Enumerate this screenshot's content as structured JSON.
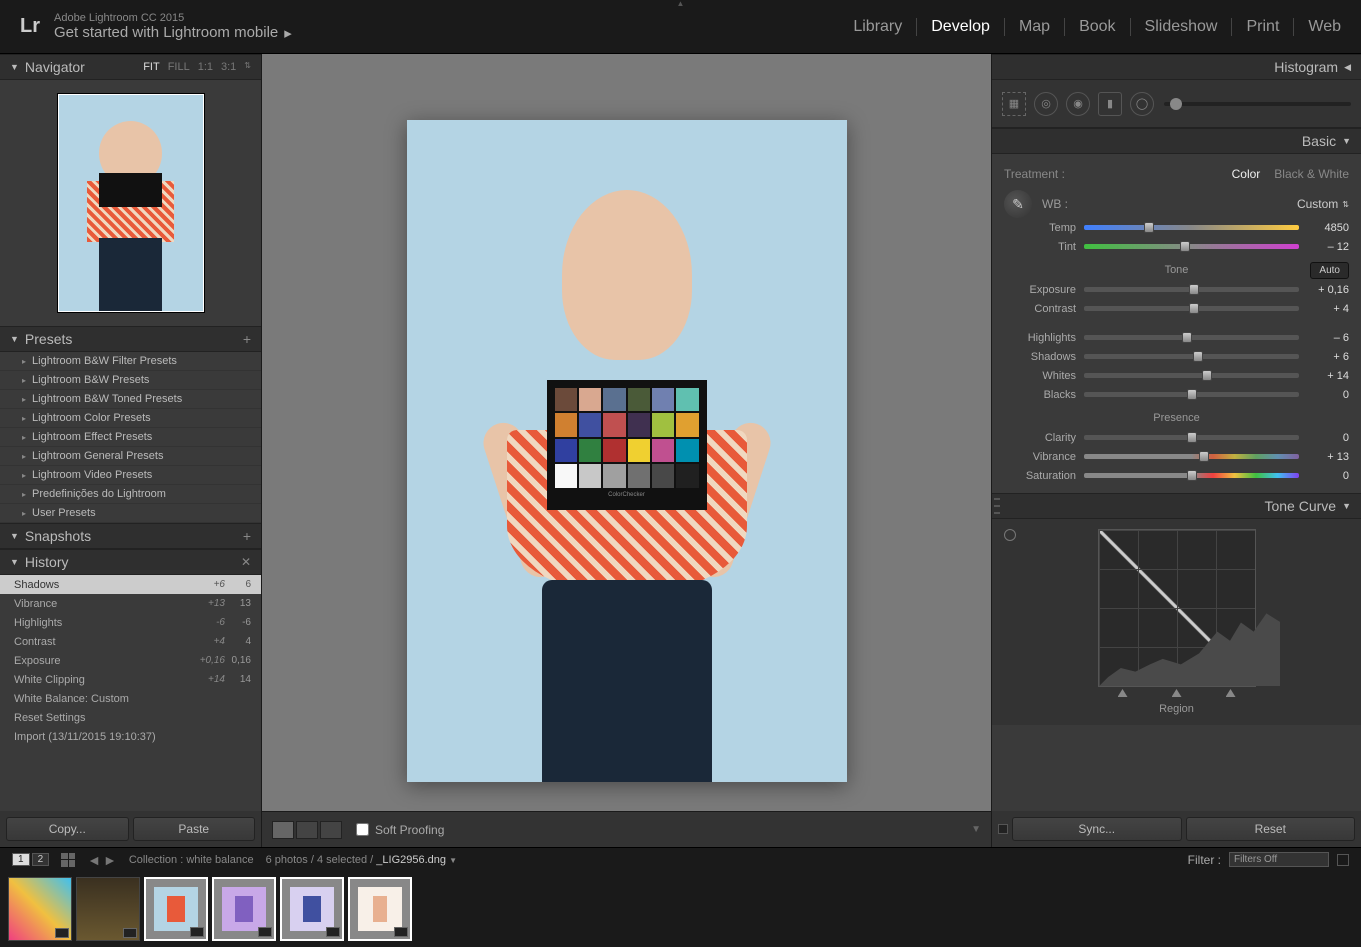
{
  "app": {
    "title": "Adobe Lightroom CC 2015",
    "subtitle": "Get started with Lightroom mobile",
    "logo_prefix": "Lr"
  },
  "modules": [
    "Library",
    "Develop",
    "Map",
    "Book",
    "Slideshow",
    "Print",
    "Web"
  ],
  "active_module": "Develop",
  "navigator": {
    "label": "Navigator",
    "zoom_modes": [
      "FIT",
      "FILL",
      "1:1",
      "3:1"
    ],
    "active_zoom": "FIT"
  },
  "presets": {
    "label": "Presets",
    "items": [
      "Lightroom B&W Filter Presets",
      "Lightroom B&W Presets",
      "Lightroom B&W Toned Presets",
      "Lightroom Color Presets",
      "Lightroom Effect Presets",
      "Lightroom General Presets",
      "Lightroom Video Presets",
      "Predefinições do Lightroom",
      "User Presets"
    ]
  },
  "snapshots": {
    "label": "Snapshots"
  },
  "history": {
    "label": "History",
    "items": [
      {
        "name": "Shadows",
        "delta": "+6",
        "val": "6",
        "sel": true
      },
      {
        "name": "Vibrance",
        "delta": "+13",
        "val": "13"
      },
      {
        "name": "Highlights",
        "delta": "-6",
        "val": "-6"
      },
      {
        "name": "Contrast",
        "delta": "+4",
        "val": "4"
      },
      {
        "name": "Exposure",
        "delta": "+0,16",
        "val": "0,16"
      },
      {
        "name": "White Clipping",
        "delta": "+14",
        "val": "14"
      },
      {
        "name": "White Balance: Custom",
        "delta": "",
        "val": ""
      },
      {
        "name": "Reset Settings",
        "delta": "",
        "val": ""
      },
      {
        "name": "Import (13/11/2015 19:10:37)",
        "delta": "",
        "val": ""
      }
    ]
  },
  "leftbtns": {
    "copy": "Copy...",
    "paste": "Paste"
  },
  "softproof": {
    "label": "Soft Proofing"
  },
  "histogram": {
    "label": "Histogram"
  },
  "basic": {
    "label": "Basic",
    "treatment_label": "Treatment :",
    "treatment_opts": [
      "Color",
      "Black & White"
    ],
    "treatment_active": "Color",
    "wb_label": "WB :",
    "wb_value": "Custom",
    "sliders": {
      "temp": {
        "label": "Temp",
        "value": "4850",
        "pos": 30
      },
      "tint": {
        "label": "Tint",
        "value": "– 12",
        "pos": 47
      }
    },
    "tone_label": "Tone",
    "auto_label": "Auto",
    "tone_sliders": [
      {
        "label": "Exposure",
        "value": "+ 0,16",
        "pos": 51
      },
      {
        "label": "Contrast",
        "value": "+ 4",
        "pos": 51
      }
    ],
    "tone_sliders2": [
      {
        "label": "Highlights",
        "value": "– 6",
        "pos": 48
      },
      {
        "label": "Shadows",
        "value": "+ 6",
        "pos": 53
      },
      {
        "label": "Whites",
        "value": "+ 14",
        "pos": 57
      },
      {
        "label": "Blacks",
        "value": "0",
        "pos": 50
      }
    ],
    "presence_label": "Presence",
    "presence_sliders": [
      {
        "label": "Clarity",
        "value": "0",
        "pos": 50,
        "track": "track-gray"
      },
      {
        "label": "Vibrance",
        "value": "+ 13",
        "pos": 56,
        "track": "track-vib"
      },
      {
        "label": "Saturation",
        "value": "0",
        "pos": 50,
        "track": "track-sat"
      }
    ]
  },
  "tonecurve": {
    "label": "Tone Curve",
    "region_label": "Region"
  },
  "rightbtns": {
    "sync": "Sync...",
    "reset": "Reset"
  },
  "filterbar": {
    "pages": [
      "1",
      "2"
    ],
    "collection": "Collection : white balance",
    "count": "6 photos / 4 selected /",
    "filename": "_LIG2956.dng",
    "filter_label": "Filter :",
    "filter_value": "Filters Off"
  },
  "colorchart_swatches": [
    "#6b4a3a",
    "#d9a890",
    "#5a7090",
    "#4a5a38",
    "#7080b0",
    "#60c0b0",
    "#d08030",
    "#4050a0",
    "#c05050",
    "#403050",
    "#a0c040",
    "#e0a030",
    "#3040a0",
    "#308040",
    "#b03030",
    "#f0d030",
    "#c05090",
    "#0090b0",
    "#f8f8f8",
    "#c8c8c8",
    "#a0a0a0",
    "#707070",
    "#484848",
    "#202020"
  ]
}
